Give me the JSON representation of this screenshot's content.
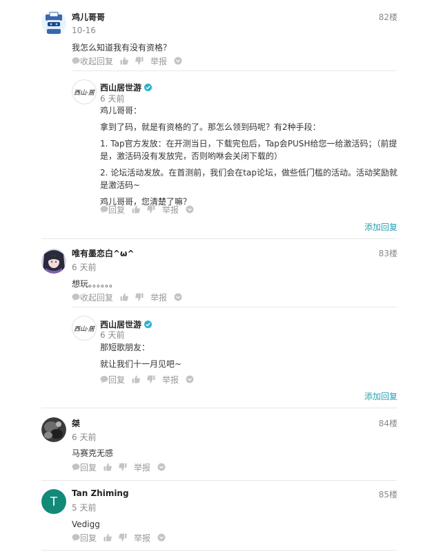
{
  "posts": [
    {
      "name": "鸡儿哥哥",
      "floor": "82楼",
      "time": "10-16",
      "content": "我怎么知道我有没有资格？",
      "actions": {
        "collapse": "收起回复",
        "report": "举报"
      },
      "reply": {
        "name": "西山居世游",
        "time": "6 天前",
        "paragraphs": [
          "鸡儿哥哥：",
          "拿到了码，就是有资格的了。那怎么领到码呢？有2种手段：",
          "1. Tap官方发放：在开测当日，下载完包后，Tap会PUSH给您一给激活码；（前提是，激活码没有发放完，否则哟咻会关闭下载的）",
          "2. 论坛活动发放。在首测前，我们会在tap论坛，做些低门槛的活动。活动奖励就是激活码~",
          "鸡儿哥哥，您清楚了嘛？"
        ],
        "reply_label": "回复",
        "report": "举报"
      },
      "add_reply": "添加回复"
    },
    {
      "name": "唯有墨恋白^ω^",
      "floor": "83楼",
      "time": "6 天前",
      "content": "想玩。。。。。。",
      "actions": {
        "collapse": "收起回复",
        "report": "举报"
      },
      "reply": {
        "name": "西山居世游",
        "time": "6 天前",
        "paragraphs": [
          "那短歌朋友：",
          "就让我们十一月见吧~"
        ],
        "reply_label": "回复",
        "report": "举报"
      },
      "add_reply": "添加回复"
    },
    {
      "name": "桀",
      "floor": "84楼",
      "time": "6 天前",
      "content": "马赛克无感",
      "actions": {
        "reply": "回复",
        "report": "举报"
      }
    },
    {
      "name": "Tan Zhiming",
      "floor": "85楼",
      "time": "5 天前",
      "content": "Vedigg",
      "avatar_letter": "T",
      "actions": {
        "reply": "回复",
        "report": "举报"
      }
    }
  ],
  "colors": {
    "accent": "#26a0b5",
    "avatar_t": "#13897a",
    "verify": "#2ab3c9"
  }
}
